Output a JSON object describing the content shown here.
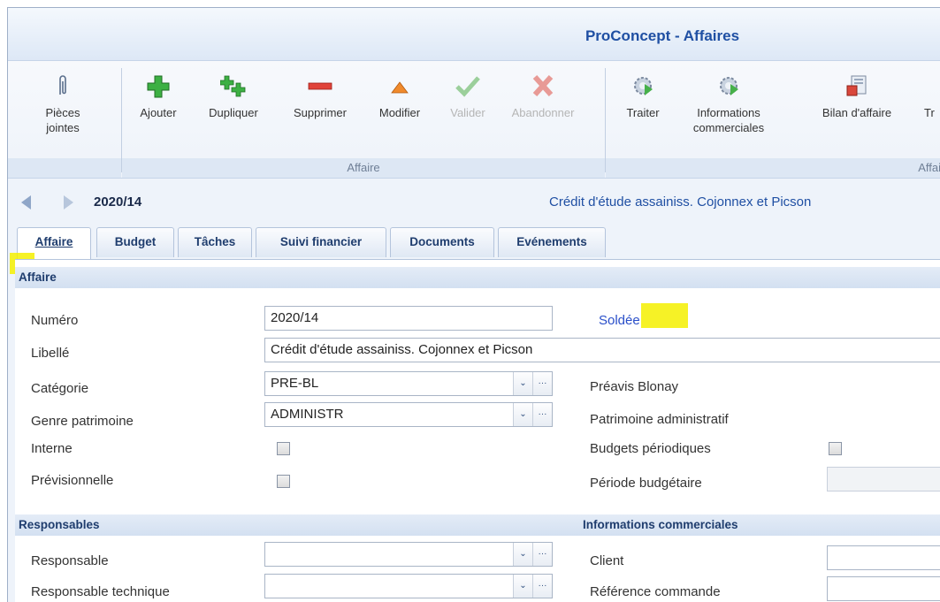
{
  "window": {
    "title": "ProConcept - Affaires"
  },
  "ribbon": {
    "buttons": [
      {
        "label": "Pièces jointes",
        "icon": "paperclip-icon"
      },
      {
        "label": "Ajouter",
        "icon": "plus-icon"
      },
      {
        "label": "Dupliquer",
        "icon": "duplicate-plus-icon"
      },
      {
        "label": "Supprimer",
        "icon": "minus-icon"
      },
      {
        "label": "Modifier",
        "icon": "edit-triangle-icon"
      },
      {
        "label": "Valider",
        "icon": "check-icon",
        "disabled": true
      },
      {
        "label": "Abandonner",
        "icon": "cross-icon",
        "disabled": true
      },
      {
        "label": "Traiter",
        "icon": "gear-play-icon"
      },
      {
        "label": "Informations commerciales",
        "icon": "gear-info-icon"
      },
      {
        "label": "Bilan d'affaire",
        "icon": "report-icon"
      },
      {
        "label": "Tr",
        "icon": "truncated-icon"
      }
    ],
    "groups": [
      {
        "label": "Affaire"
      },
      {
        "label": "Affai"
      }
    ]
  },
  "record": {
    "number": "2020/14",
    "description": "Crédit d'étude assainiss. Cojonnex et Picson"
  },
  "tabs": [
    "Affaire",
    "Budget",
    "Tâches",
    "Suivi financier",
    "Documents",
    "Evénements"
  ],
  "sections": {
    "affaire": "Affaire",
    "responsables": "Responsables",
    "infos_commerciales": "Informations commerciales"
  },
  "form": {
    "numero": {
      "label": "Numéro",
      "value": "2020/14"
    },
    "status": "Soldée",
    "libelle": {
      "label": "Libellé",
      "value": "Crédit d'étude assainiss. Cojonnex et Picson"
    },
    "categorie": {
      "label": "Catégorie",
      "value": "PRE-BL",
      "description": "Préavis Blonay"
    },
    "genre": {
      "label": "Genre patrimoine",
      "value": "ADMINISTR",
      "description": "Patrimoine administratif"
    },
    "interne": {
      "label": "Interne"
    },
    "previsionnelle": {
      "label": "Prévisionnelle"
    },
    "budgets_periodiques": {
      "label": "Budgets périodiques"
    },
    "periode_budgetaire": {
      "label": "Période budgétaire"
    },
    "responsable": {
      "label": "Responsable",
      "value": ""
    },
    "responsable_technique": {
      "label": "Responsable technique",
      "value": ""
    },
    "client": {
      "label": "Client"
    },
    "reference_commande": {
      "label": "Référence commande"
    },
    "combo_arrow": "❯",
    "combo_more": "···"
  },
  "colors": {
    "accent": "#1f4fa3",
    "highlight": "#f4f000",
    "link": "#2a4fc9"
  }
}
